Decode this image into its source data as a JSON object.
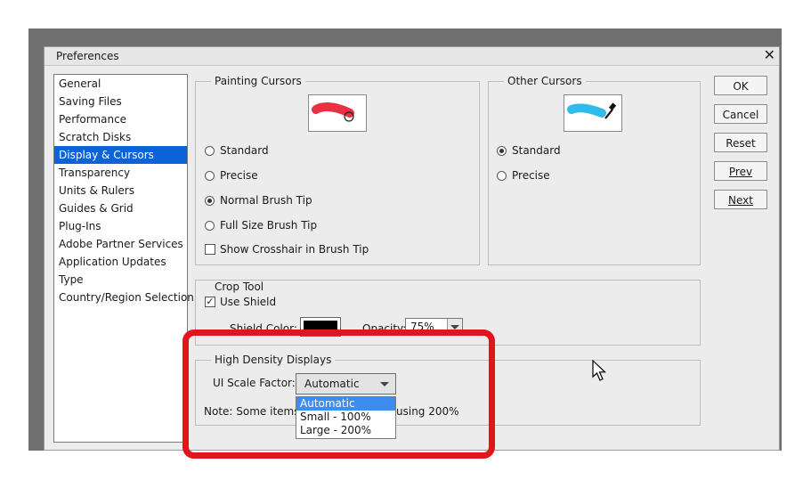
{
  "dialog": {
    "title": "Preferences"
  },
  "categories": [
    {
      "label": "General",
      "selected": false
    },
    {
      "label": "Saving Files",
      "selected": false
    },
    {
      "label": "Performance",
      "selected": false
    },
    {
      "label": "Scratch Disks",
      "selected": false
    },
    {
      "label": "Display & Cursors",
      "selected": true
    },
    {
      "label": "Transparency",
      "selected": false
    },
    {
      "label": "Units & Rulers",
      "selected": false
    },
    {
      "label": "Guides & Grid",
      "selected": false
    },
    {
      "label": "Plug-Ins",
      "selected": false
    },
    {
      "label": "Adobe Partner Services",
      "selected": false
    },
    {
      "label": "Application Updates",
      "selected": false
    },
    {
      "label": "Type",
      "selected": false
    },
    {
      "label": "Country/Region Selection",
      "selected": false
    }
  ],
  "painting_cursors": {
    "title": "Painting Cursors",
    "options": [
      {
        "label": "Standard",
        "checked": false
      },
      {
        "label": "Precise",
        "checked": false
      },
      {
        "label": "Normal Brush Tip",
        "checked": true
      },
      {
        "label": "Full Size Brush Tip",
        "checked": false
      }
    ],
    "crosshair": {
      "label": "Show Crosshair in Brush Tip",
      "checked": false
    }
  },
  "other_cursors": {
    "title": "Other Cursors",
    "options": [
      {
        "label": "Standard",
        "checked": true
      },
      {
        "label": "Precise",
        "checked": false
      }
    ]
  },
  "crop_tool": {
    "title": "Crop Tool",
    "use_shield": {
      "label": "Use Shield",
      "checked": true
    },
    "shield_color_label": "Shield Color:",
    "shield_color": "#000000",
    "opacity_label": "Opacity:",
    "opacity_value": "75%"
  },
  "high_density": {
    "title": "High Density Displays",
    "scale_label": "UI Scale Factor:",
    "scale_value": "Automatic",
    "note_left": "Note: Some items",
    "note_right": "using 200%",
    "options": [
      {
        "label": "Automatic",
        "selected": true
      },
      {
        "label": "Small - 100%",
        "selected": false
      },
      {
        "label": "Large - 200%",
        "selected": false
      }
    ]
  },
  "buttons": {
    "ok": "OK",
    "cancel": "Cancel",
    "reset": "Reset",
    "prev": "Prev",
    "next": "Next"
  },
  "colors": {
    "selection": "#0a64d8",
    "highlight": "#e0161c",
    "brush_red": "#e8192c",
    "brush_cyan": "#19b5e8"
  },
  "icons": {
    "close": "close-icon",
    "dropdown": "chevron-down-icon",
    "cursor": "mouse-pointer-icon"
  }
}
